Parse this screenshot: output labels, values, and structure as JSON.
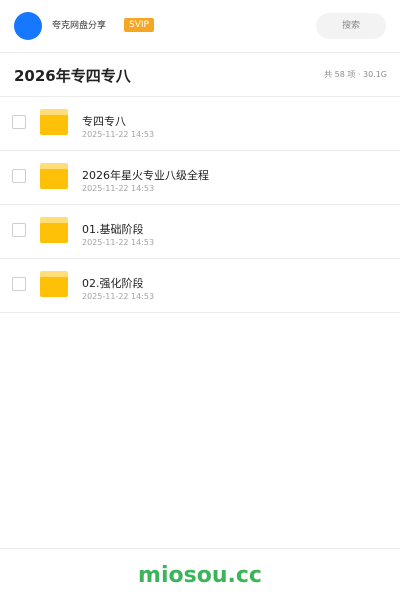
{
  "header": {
    "app_name": "夸克网盘分享",
    "badge": "SVIP",
    "search_placeholder": "搜索"
  },
  "folder": {
    "title": "2026年专四专八",
    "meta": "共 58 项 · 30.1G"
  },
  "items": [
    {
      "name": "专四专八",
      "date": "2025-11-22 14:53"
    },
    {
      "name": "2026年星火专业八级全程",
      "date": "2025-11-22 14:53"
    },
    {
      "name": "01.基础阶段",
      "date": "2025-11-22 14:53"
    },
    {
      "name": "02.强化阶段",
      "date": "2025-11-22 14:53"
    }
  ],
  "footer": {
    "watermark": "miosou.cc"
  },
  "colors": {
    "avatar": "#1677ff",
    "badge": "#f5a623",
    "folder": "#ffc107",
    "watermark": "#3cb55a"
  }
}
